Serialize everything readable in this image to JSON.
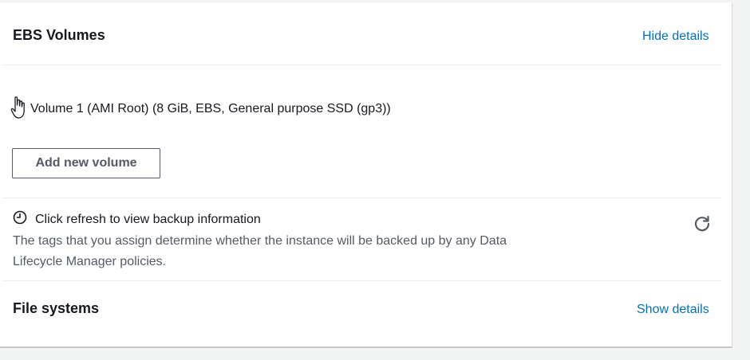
{
  "ebs": {
    "title": "EBS Volumes",
    "toggle_label": "Hide details",
    "volume_label": "Volume 1 (AMI Root) (8 GiB, EBS, General purpose SSD (gp3))",
    "add_button": "Add new volume"
  },
  "backup": {
    "title": "Click refresh to view backup information",
    "description": "The tags that you assign determine whether the instance will be backed up by any Data Lifecycle Manager policies.",
    "refresh_icon": "refresh-icon",
    "clock_icon": "clock-icon"
  },
  "file_systems": {
    "title": "File systems",
    "toggle_label": "Show details"
  },
  "colors": {
    "link": "#0073bb",
    "text": "#16191f",
    "muted": "#545b64"
  }
}
